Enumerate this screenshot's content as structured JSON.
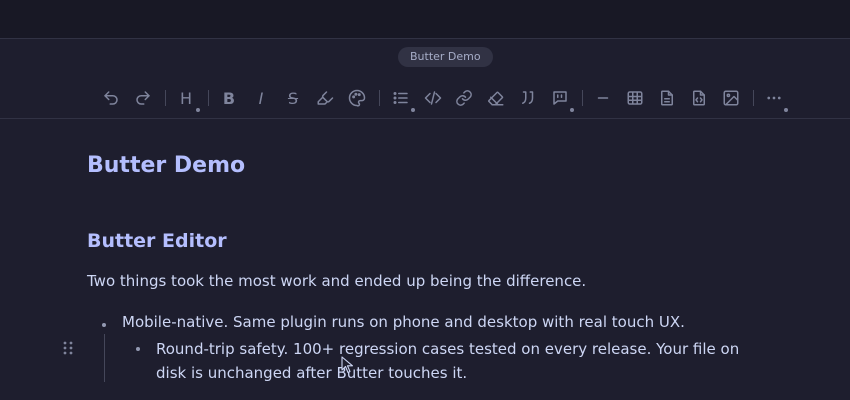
{
  "app": {
    "doc_pill": "Butter Demo"
  },
  "toolbar": {
    "items": [
      {
        "icon": "undo-icon"
      },
      {
        "icon": "redo-icon"
      },
      {
        "icon": "heading-icon",
        "label": "H"
      },
      {
        "icon": "bold-icon",
        "label": "B"
      },
      {
        "icon": "italic-icon",
        "label": "I"
      },
      {
        "icon": "strikethrough-icon",
        "label": "S"
      },
      {
        "icon": "highlighter-icon"
      },
      {
        "icon": "palette-icon"
      },
      {
        "icon": "list-icon"
      },
      {
        "icon": "code-icon"
      },
      {
        "icon": "link-icon"
      },
      {
        "icon": "eraser-icon"
      },
      {
        "icon": "quote-icon"
      },
      {
        "icon": "callout-icon"
      },
      {
        "icon": "horizontal-rule-icon"
      },
      {
        "icon": "table-icon"
      },
      {
        "icon": "document-icon"
      },
      {
        "icon": "code-file-icon"
      },
      {
        "icon": "image-icon"
      },
      {
        "icon": "more-icon"
      }
    ]
  },
  "document": {
    "title": "Butter Demo",
    "heading": "Butter Editor",
    "paragraph": "Two things took the most work and ended up being the difference.",
    "list": [
      {
        "text": "Mobile-native. Same plugin runs on phone and desktop with real touch UX.",
        "children": [
          {
            "text": "Round-trip safety. 100+ regression cases tested on every release. Your file on disk is unchanged after Butter touches it."
          }
        ]
      }
    ]
  },
  "colors": {
    "background": "#1e1e2e",
    "titlebar": "#181825",
    "heading": "#b4befe",
    "text": "#cdd6f4",
    "icon": "#7f849c"
  }
}
